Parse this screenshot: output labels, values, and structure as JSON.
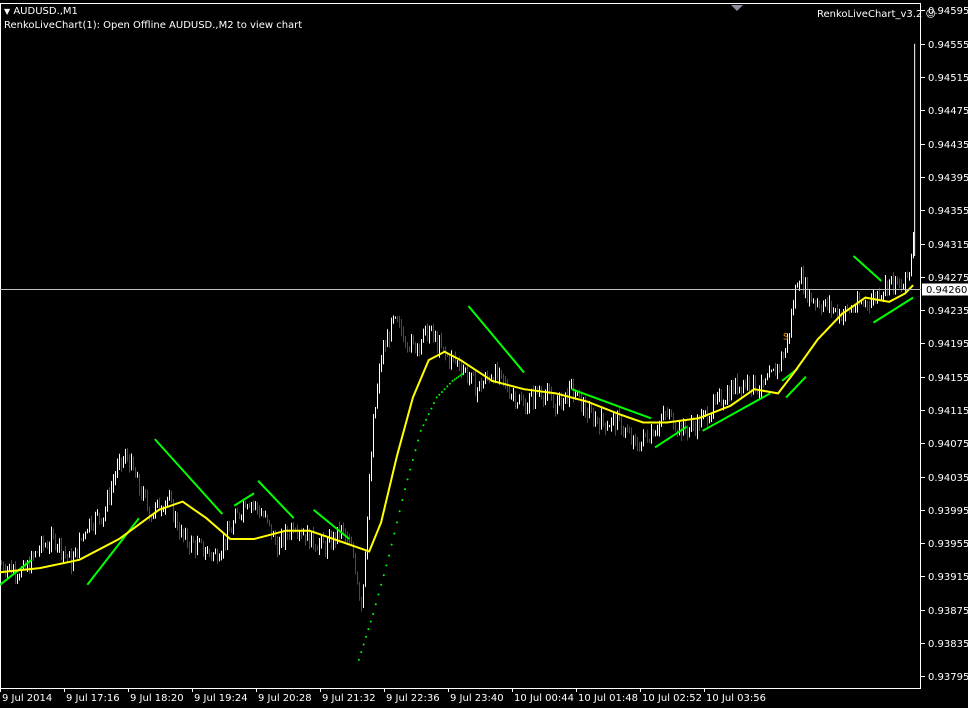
{
  "window": {
    "symbol_label": "AUDUSD.,M1",
    "status_text": "RenkoLiveChart(1): Open Offline AUDUSD.,M2 to view chart",
    "indicator_name": "RenkoLiveChart_v3.2",
    "menu_icon": "triangle-down-icon",
    "smile_icon": "smiley-icon"
  },
  "colors": {
    "background": "#000000",
    "frame": "#ffffff",
    "candle_bull": "#ffffff",
    "candle_bear": "#ff0000",
    "ma": "#ffff00",
    "stop_line": "#00ff00",
    "current_price_line": "#c0c0c0",
    "signal": "#ffa500",
    "price_tag_bg": "#ffffff",
    "price_tag_text": "#000000"
  },
  "chart_data": {
    "type": "line",
    "title": "",
    "ylim": [
      0.93781,
      0.94604
    ],
    "y_ticks": [
      "0.94595",
      "0.94555",
      "0.94515",
      "0.94475",
      "0.94435",
      "0.94395",
      "0.94355",
      "0.94315",
      "0.94275",
      "0.94235",
      "0.94195",
      "0.94155",
      "0.94115",
      "0.94075",
      "0.94035",
      "0.93995",
      "0.93955",
      "0.93915",
      "0.93875",
      "0.93835",
      "0.93795"
    ],
    "x_ticks": [
      "9 Jul 2014",
      "9 Jul 17:16",
      "9 Jul 18:20",
      "9 Jul 19:24",
      "9 Jul 20:28",
      "9 Jul 21:32",
      "9 Jul 22:36",
      "9 Jul 23:40",
      "10 Jul 00:44",
      "10 Jul 01:48",
      "10 Jul 02:52",
      "10 Jul 03:56"
    ],
    "x_range": [
      0,
      11.6
    ],
    "current_price": {
      "value": 0.9426,
      "label": "0.94260"
    },
    "price_path": [
      [
        0.0,
        0.9393
      ],
      [
        0.3,
        0.9392
      ],
      [
        0.5,
        0.9395
      ],
      [
        0.7,
        0.9396
      ],
      [
        0.9,
        0.9393
      ],
      [
        1.1,
        0.9398
      ],
      [
        1.3,
        0.9399
      ],
      [
        1.45,
        0.9404
      ],
      [
        1.6,
        0.9406
      ],
      [
        1.75,
        0.9402
      ],
      [
        1.9,
        0.9399
      ],
      [
        2.1,
        0.9401
      ],
      [
        2.3,
        0.9396
      ],
      [
        2.5,
        0.9395
      ],
      [
        2.7,
        0.9394
      ],
      [
        2.9,
        0.9397
      ],
      [
        3.1,
        0.9401
      ],
      [
        3.3,
        0.9399
      ],
      [
        3.5,
        0.9395
      ],
      [
        3.7,
        0.9398
      ],
      [
        3.9,
        0.9396
      ],
      [
        4.1,
        0.9395
      ],
      [
        4.3,
        0.9397
      ],
      [
        4.45,
        0.9394
      ],
      [
        4.55,
        0.9388
      ],
      [
        4.7,
        0.941
      ],
      [
        4.8,
        0.9418
      ],
      [
        4.95,
        0.9422
      ],
      [
        5.05,
        0.9421
      ],
      [
        5.2,
        0.9419
      ],
      [
        5.4,
        0.9421
      ],
      [
        5.6,
        0.9418
      ],
      [
        5.8,
        0.9417
      ],
      [
        6.0,
        0.9414
      ],
      [
        6.2,
        0.9416
      ],
      [
        6.4,
        0.9414
      ],
      [
        6.6,
        0.9412
      ],
      [
        6.8,
        0.9414
      ],
      [
        7.0,
        0.9412
      ],
      [
        7.2,
        0.9414
      ],
      [
        7.4,
        0.9411
      ],
      [
        7.6,
        0.941
      ],
      [
        7.8,
        0.941
      ],
      [
        8.0,
        0.9407
      ],
      [
        8.2,
        0.9409
      ],
      [
        8.4,
        0.9411
      ],
      [
        8.6,
        0.9409
      ],
      [
        8.8,
        0.941
      ],
      [
        9.0,
        0.9412
      ],
      [
        9.2,
        0.9414
      ],
      [
        9.4,
        0.9415
      ],
      [
        9.6,
        0.9414
      ],
      [
        9.75,
        0.9416
      ],
      [
        9.9,
        0.9419
      ],
      [
        10.05,
        0.9428
      ],
      [
        10.2,
        0.9425
      ],
      [
        10.4,
        0.9424
      ],
      [
        10.6,
        0.9423
      ],
      [
        10.8,
        0.9424
      ],
      [
        11.0,
        0.9425
      ],
      [
        11.2,
        0.9427
      ],
      [
        11.35,
        0.9426
      ],
      [
        11.45,
        0.9428
      ],
      [
        11.5,
        0.9433
      ]
    ],
    "spike": {
      "x": 11.52,
      "low": 0.943,
      "high": 0.94555
    },
    "series": [
      {
        "type": "line",
        "points": [
          [
            0.0,
            0.9392
          ],
          [
            0.5,
            0.93925
          ],
          [
            1.0,
            0.93935
          ],
          [
            1.5,
            0.9396
          ],
          [
            2.0,
            0.93995
          ],
          [
            2.3,
            0.94005
          ],
          [
            2.6,
            0.93985
          ],
          [
            2.9,
            0.9396
          ],
          [
            3.2,
            0.9396
          ],
          [
            3.6,
            0.9397
          ],
          [
            3.9,
            0.9397
          ],
          [
            4.2,
            0.9396
          ],
          [
            4.5,
            0.9395
          ],
          [
            4.65,
            0.93945
          ],
          [
            4.8,
            0.9398
          ],
          [
            5.0,
            0.9406
          ],
          [
            5.2,
            0.9413
          ],
          [
            5.4,
            0.94175
          ],
          [
            5.6,
            0.94185
          ],
          [
            5.8,
            0.94175
          ],
          [
            6.2,
            0.9415
          ],
          [
            6.6,
            0.9414
          ],
          [
            7.0,
            0.94135
          ],
          [
            7.4,
            0.94125
          ],
          [
            7.8,
            0.9411
          ],
          [
            8.1,
            0.941
          ],
          [
            8.4,
            0.941
          ],
          [
            8.8,
            0.94105
          ],
          [
            9.2,
            0.9412
          ],
          [
            9.5,
            0.9414
          ],
          [
            9.8,
            0.94135
          ],
          [
            10.0,
            0.9416
          ],
          [
            10.3,
            0.942
          ],
          [
            10.6,
            0.9423
          ],
          [
            10.9,
            0.9425
          ],
          [
            11.2,
            0.94245
          ],
          [
            11.4,
            0.94255
          ],
          [
            11.5,
            0.94265
          ]
        ]
      },
      {
        "type": "segments",
        "segments": [
          [
            [
              0.0,
              0.93905
            ],
            [
              0.4,
              0.93935
            ]
          ],
          [
            [
              1.1,
              0.93905
            ],
            [
              1.75,
              0.93985
            ]
          ],
          [
            [
              1.95,
              0.9408
            ],
            [
              2.8,
              0.9399
            ]
          ],
          [
            [
              2.95,
              0.94
            ],
            [
              3.2,
              0.94015
            ]
          ],
          [
            [
              3.25,
              0.9403
            ],
            [
              3.7,
              0.93985
            ]
          ],
          [
            [
              3.95,
              0.93995
            ],
            [
              4.4,
              0.9396
            ]
          ],
          [
            [
              5.9,
              0.9424
            ],
            [
              6.6,
              0.9416
            ]
          ],
          [
            [
              7.2,
              0.9414
            ],
            [
              8.2,
              0.94105
            ]
          ],
          [
            [
              8.25,
              0.9407
            ],
            [
              8.65,
              0.94095
            ]
          ],
          [
            [
              8.85,
              0.9409
            ],
            [
              9.7,
              0.94135
            ]
          ],
          [
            [
              9.85,
              0.9415
            ],
            [
              10.05,
              0.94165
            ]
          ],
          [
            [
              9.9,
              0.9413
            ],
            [
              10.15,
              0.94155
            ]
          ],
          [
            [
              10.75,
              0.943
            ],
            [
              11.1,
              0.9427
            ]
          ],
          [
            [
              11.0,
              0.9422
            ],
            [
              11.5,
              0.9425
            ]
          ]
        ]
      },
      {
        "type": "dots",
        "points": [
          [
            4.52,
            0.93815
          ],
          [
            4.7,
            0.9387
          ],
          [
            4.9,
            0.9394
          ],
          [
            5.1,
            0.9402
          ],
          [
            5.3,
            0.9409
          ],
          [
            5.5,
            0.9413
          ],
          [
            5.7,
            0.9415
          ],
          [
            5.85,
            0.9416
          ]
        ]
      }
    ],
    "signals": [
      {
        "x": 9.9,
        "y": 0.942,
        "label": "S"
      }
    ]
  }
}
